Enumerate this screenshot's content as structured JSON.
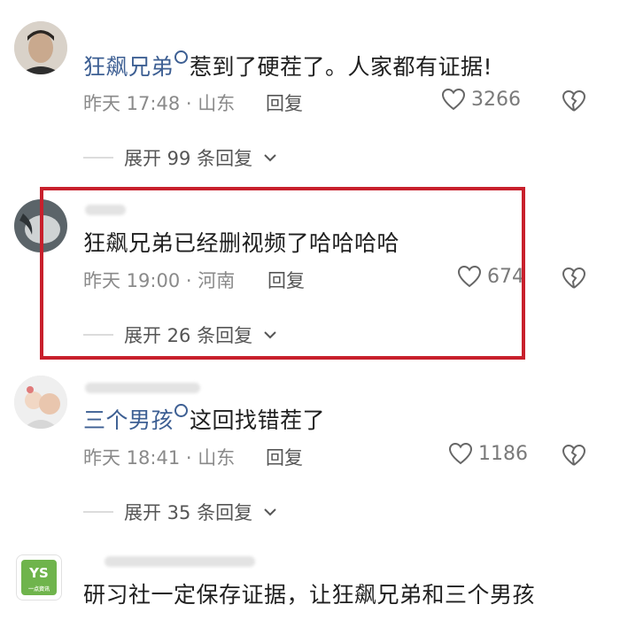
{
  "comments": [
    {
      "mention": "狂飙兄弟",
      "text": "惹到了硬茬了。人家都有证据!",
      "time": "昨天 17:48 · 山东",
      "reply_label": "回复",
      "likes": "3266",
      "expand_label": "展开 99 条回复"
    },
    {
      "text": "狂飙兄弟已经删视频了哈哈哈哈",
      "time": "昨天 19:00 · 河南",
      "reply_label": "回复",
      "likes": "674",
      "expand_label": "展开 26 条回复"
    },
    {
      "mention": "三个男孩",
      "text": "这回找错茬了",
      "time": "昨天 18:41 · 山东",
      "reply_label": "回复",
      "likes": "1186",
      "expand_label": "展开 35 条回复"
    },
    {
      "text": "研习社一定保存证据，让狂飙兄弟和三个男孩"
    }
  ],
  "logo": {
    "main": "YS",
    "sub": "一点资讯"
  },
  "colors": {
    "mention": "#3d5f93",
    "highlight": "#c8202c",
    "logo_green": "#6fb44c"
  }
}
